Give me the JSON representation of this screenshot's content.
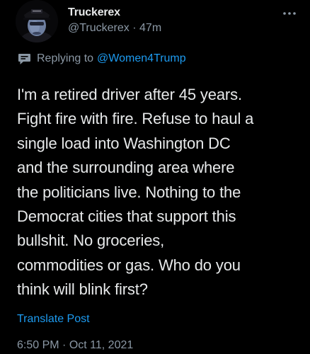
{
  "author": {
    "display_name": "Truckerex",
    "handle": "@Truckerex",
    "separator": "·",
    "relative_time": "47m"
  },
  "reply": {
    "prefix": "Replying to",
    "to_handle": "@Women4Trump"
  },
  "post": {
    "lines": [
      "I'm a retired driver after 45 years.",
      "Fight fire with fire. Refuse to haul a",
      "single load into Washington DC",
      "and the surrounding area where",
      "the politicians live. Nothing to the",
      "Democrat cities that support this",
      "bullshit. No groceries,",
      "commodities or gas. Who do you",
      "think will blink first?"
    ]
  },
  "actions": {
    "translate_label": "Translate Post",
    "more_icon": "more-horizontal-icon"
  },
  "footer": {
    "time": "6:50 PM",
    "separator": "·",
    "date": "Oct 11, 2021"
  },
  "colors": {
    "background": "#000000",
    "primary_text": "#e7e9ea",
    "secondary_text": "#8b98a5",
    "accent": "#1d9bf0"
  }
}
